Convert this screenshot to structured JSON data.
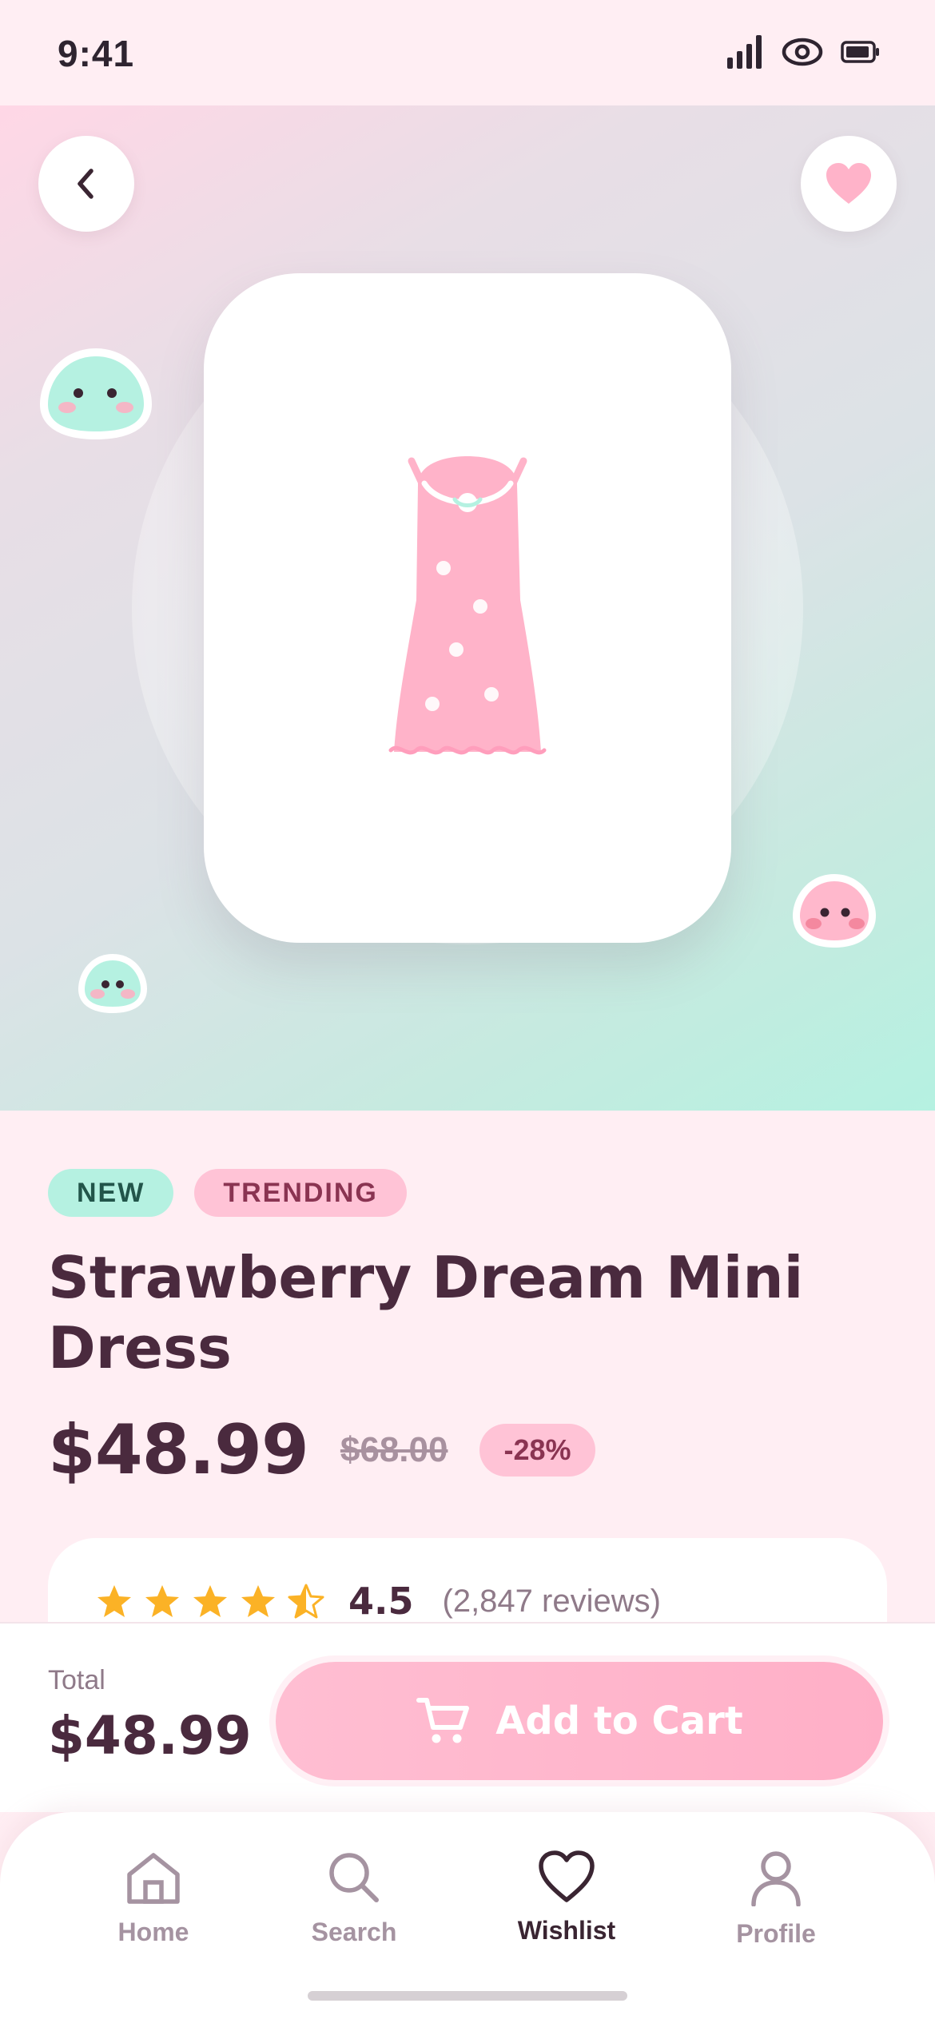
{
  "status_bar": {
    "time": "9:41"
  },
  "product": {
    "tags": [
      "NEW",
      "TRENDING"
    ],
    "title": "Strawberry Dream Mini Dress",
    "price": "$48.99",
    "original_price": "$68.00",
    "discount": "-28%",
    "rating": "4.5",
    "reviews": "(2,847 reviews)",
    "rating_stars": 4.5,
    "favorited": true
  },
  "checkout": {
    "total_label": "Total",
    "total_value": "$48.99",
    "add_to_cart_label": "Add to Cart"
  },
  "tab_bar": {
    "items": [
      {
        "label": "Home",
        "icon": "home-icon",
        "active": false
      },
      {
        "label": "Search",
        "icon": "search-icon",
        "active": false
      },
      {
        "label": "Wishlist",
        "icon": "heart-icon",
        "active": true
      },
      {
        "label": "Profile",
        "icon": "profile-icon",
        "active": false
      }
    ]
  },
  "colors": {
    "accent_pink": "#FFB3C9",
    "mint": "#B5F1E1",
    "text_dark": "#4A2A3E",
    "star": "#FBB226"
  }
}
